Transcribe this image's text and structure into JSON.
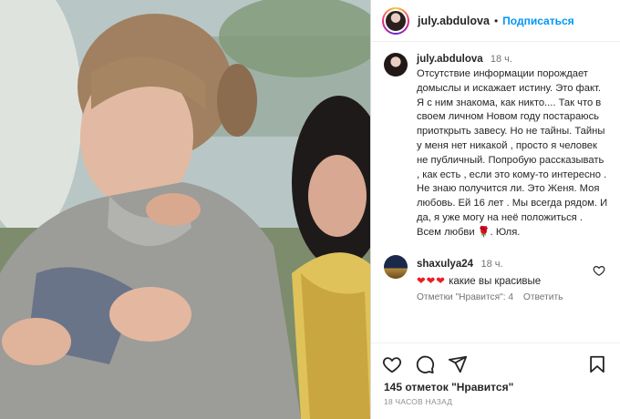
{
  "post": {
    "username": "july.abdulova",
    "follow_label": "Подписаться",
    "dot": "•"
  },
  "caption": {
    "username": "july.abdulova",
    "time": "18 ч.",
    "text_part1": "Отсутствие информации порождает домыслы и искажает истину. Это факт. Я с ним знакома, как никто.... Так что в своем личном Новом году постараюсь приоткрыть завесу. Но не тайны. Тайны у меня нет никакой , просто я человек не публичный. Попробую рассказывать , как есть , если это кому-то интересно . Не знаю получится ли. Это Женя. Моя любовь. Ей 16 лет . Мы всегда рядом. И да, я уже могу на неё положиться . Всем любви ",
    "rose": "🌹",
    "text_part2": ". Юля."
  },
  "comment": {
    "username": "shaxulya24",
    "time": "18 ч.",
    "hearts": "❤❤❤",
    "text": "какие вы красивые",
    "likes_label": "Отметки \"Нравится\": 4",
    "reply_label": "Ответить"
  },
  "footer": {
    "likes_count": "145",
    "likes_text": "отметок \"Нравится\"",
    "posted_ago": "18 ЧАСОВ НАЗАД"
  },
  "icons": {
    "like": "heart-icon",
    "comment": "comment-icon",
    "share": "share-icon",
    "save": "bookmark-icon"
  },
  "colors": {
    "accent": "#0095f6",
    "heart": "#ed1c24",
    "muted": "#737373"
  }
}
